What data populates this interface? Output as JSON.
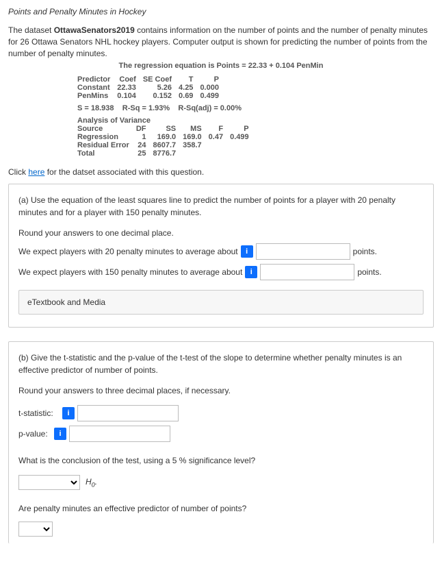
{
  "title": "Points and Penalty Minutes in Hockey",
  "intro_pre": "The dataset ",
  "intro_bold": "OttawaSenators2019",
  "intro_post": " contains information on the number of points and the number of penalty minutes for 26 Ottawa Senators NHL hockey players. Computer output is shown for predicting the number of points from the number of penalty minutes.",
  "regression_eq": "The regression equation is Points = 22.33 + 0.104 PenMin",
  "coef_table": {
    "headers": [
      "Predictor",
      "Coef",
      "SE Coef",
      "T",
      "P"
    ],
    "rows": [
      [
        "Constant",
        "22.33",
        "5.26",
        "4.25",
        "0.000"
      ],
      [
        "PenMins",
        "0.104",
        "0.152",
        "0.69",
        "0.499"
      ]
    ]
  },
  "s_line": {
    "s": "S = 18.938",
    "rsq": "R-Sq = 1.93%",
    "rsqadj": "R-Sq(adj) = 0.00%"
  },
  "anova": {
    "title": "Analysis of Variance",
    "headers": [
      "Source",
      "DF",
      "SS",
      "MS",
      "F",
      "P"
    ],
    "rows": [
      [
        "Regression",
        "1",
        "169.0",
        "169.0",
        "0.47",
        "0.499"
      ],
      [
        "Residual Error",
        "24",
        "8607.7",
        "358.7",
        "",
        ""
      ],
      [
        "Total",
        "25",
        "8776.7",
        "",
        "",
        ""
      ]
    ]
  },
  "click_pre": "Click ",
  "click_link": "here",
  "click_post": " for the datset associated with this question.",
  "part_a": {
    "prompt": "(a) Use the equation of the least squares line to predict the number of points for a player with 20 penalty minutes and for a player with 150 penalty minutes.",
    "round": "Round your answers to one decimal place.",
    "line1_pre": "We expect players with 20 penalty minutes to average about",
    "line1_post": "points.",
    "line2_pre": "We expect players with 150 penalty minutes to average about",
    "line2_post": "points.",
    "etext": "eTextbook and Media"
  },
  "part_b": {
    "prompt": "(b) Give the t-statistic and the p-value of the t-test of the slope to determine whether penalty minutes is an effective predictor of number of points.",
    "round": "Round your answers to three decimal places, if necessary.",
    "tstat_label": "t-statistic:",
    "pval_label": "p-value:",
    "concl_q": "What is the conclusion of the test, using a 5 %  significance level?",
    "h0": "H",
    "h0_sub": "0",
    "h0_punct": ".",
    "effective_q": "Are penalty minutes an effective predictor of number of points?"
  },
  "info_glyph": "i"
}
